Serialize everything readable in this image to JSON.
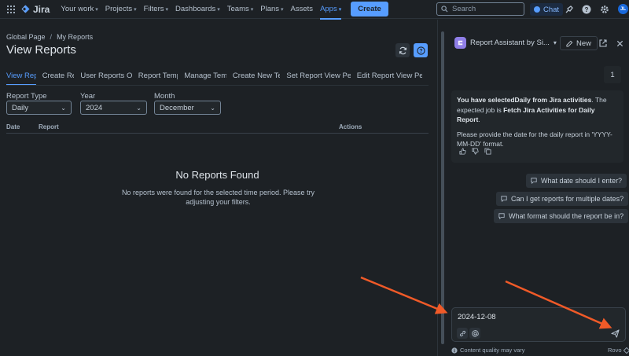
{
  "topnav": {
    "logo": "Jira",
    "items": [
      {
        "label": "Your work",
        "has_chevron": true
      },
      {
        "label": "Projects",
        "has_chevron": true
      },
      {
        "label": "Filters",
        "has_chevron": true
      },
      {
        "label": "Dashboards",
        "has_chevron": true
      },
      {
        "label": "Teams",
        "has_chevron": true
      },
      {
        "label": "Plans",
        "has_chevron": true
      },
      {
        "label": "Assets",
        "has_chevron": false
      },
      {
        "label": "Apps",
        "has_chevron": true,
        "active": true
      }
    ],
    "create_label": "Create",
    "search_placeholder": "Search",
    "chat_label": "Chat",
    "avatar_initials": "JL",
    "icons": [
      "apps-grid-icon",
      "jira-logo-icon",
      "search-icon",
      "notifications-icon",
      "help-icon",
      "settings-icon"
    ]
  },
  "main": {
    "breadcrumb": [
      "Global Page",
      "My Reports"
    ],
    "title": "View Reports",
    "tabs": [
      {
        "label": "View Reports",
        "active": true
      },
      {
        "label": "Create Reports"
      },
      {
        "label": "User Reports Overview"
      },
      {
        "label": "Report Templates"
      },
      {
        "label": "Manage Templates"
      },
      {
        "label": "Create New Template"
      },
      {
        "label": "Set Report View Permissions"
      },
      {
        "label": "Edit Report View Permissions"
      }
    ],
    "filters": {
      "report_type": {
        "label": "Report Type",
        "value": "Daily"
      },
      "year": {
        "label": "Year",
        "value": "2024"
      },
      "month": {
        "label": "Month",
        "value": "December"
      }
    },
    "table_headers": [
      "Date",
      "Report",
      "Actions"
    ],
    "empty_title": "No Reports Found",
    "empty_message": "No reports were found for the selected time period. Please try adjusting your filters."
  },
  "panel": {
    "title": "Report Assistant by Si...",
    "new_label": "New",
    "user_message": "1",
    "assistant": {
      "p1_pre": "You have selected",
      "p1_bold1": "Daily from Jira activities",
      "p1_mid": ". The expected job is ",
      "p1_bold2": "Fetch Jira Activities for Daily Report",
      "p1_end": ".",
      "p2": "Please provide the date for the daily report in 'YYYY-MM-DD' format."
    },
    "suggestions": [
      "What date should I enter?",
      "Can I get reports for multiple dates?",
      "What format should the report be in?"
    ],
    "composer_value": "2024-12-08",
    "footer_note": "Content quality may vary",
    "brand": "Rovo"
  },
  "colors": {
    "accent": "#579dff",
    "background": "#1d2125",
    "surface": "#22272b",
    "arrow": "#f05a28",
    "rovo": "#8f7ee7"
  }
}
